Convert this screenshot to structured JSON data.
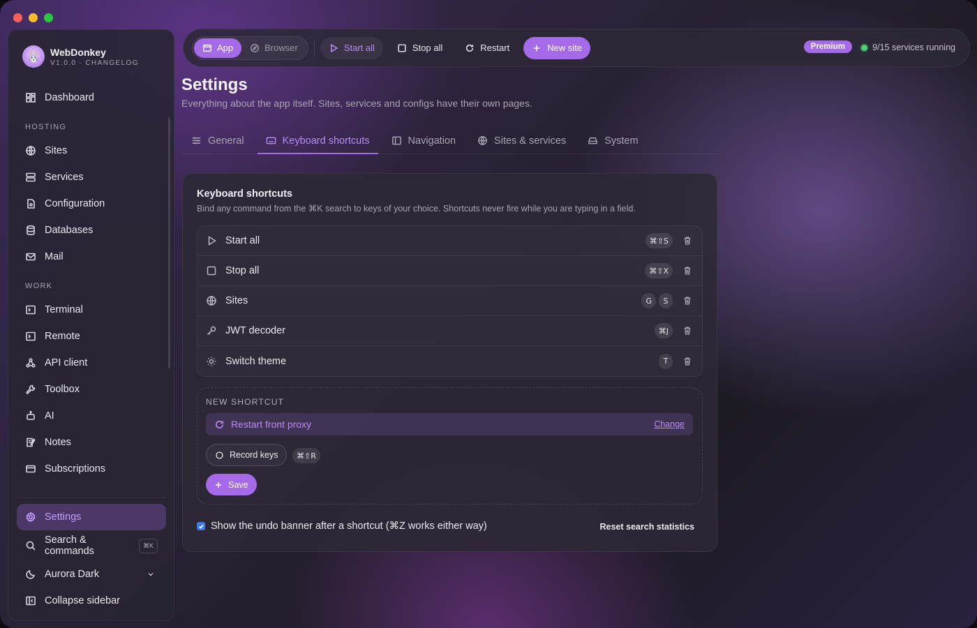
{
  "app": {
    "name": "WebDonkey",
    "version": "V1.0.0 · CHANGELOG"
  },
  "sidebar": {
    "top_items": [
      {
        "label": "Dashboard",
        "icon": "dashboard-icon"
      }
    ],
    "sections": [
      {
        "title": "HOSTING",
        "items": [
          {
            "label": "Sites",
            "icon": "globe-icon"
          },
          {
            "label": "Services",
            "icon": "server-icon"
          },
          {
            "label": "Configuration",
            "icon": "config-file-icon"
          },
          {
            "label": "Databases",
            "icon": "database-icon"
          },
          {
            "label": "Mail",
            "icon": "mail-icon"
          }
        ]
      },
      {
        "title": "WORK",
        "items": [
          {
            "label": "Terminal",
            "icon": "terminal-icon"
          },
          {
            "label": "Remote",
            "icon": "remote-icon"
          },
          {
            "label": "API client",
            "icon": "api-icon"
          },
          {
            "label": "Toolbox",
            "icon": "wrench-icon"
          },
          {
            "label": "AI",
            "icon": "robot-icon"
          },
          {
            "label": "Notes",
            "icon": "notes-icon"
          },
          {
            "label": "Subscriptions",
            "icon": "card-icon"
          }
        ]
      }
    ],
    "bottom": {
      "settings": "Settings",
      "search": "Search & commands",
      "search_kbd": "⌘K",
      "theme": "Aurora Dark",
      "collapse": "Collapse sidebar"
    }
  },
  "topbar": {
    "mode_app": "App",
    "mode_browser": "Browser",
    "start_all": "Start all",
    "stop_all": "Stop all",
    "restart": "Restart",
    "new_site": "New site",
    "premium": "Premium",
    "services_status": "9/15 services running"
  },
  "page": {
    "title": "Settings",
    "subtitle": "Everything about the app itself. Sites, services and configs have their own pages."
  },
  "tabs": [
    {
      "label": "General",
      "icon": "sliders-icon",
      "active": false
    },
    {
      "label": "Keyboard shortcuts",
      "icon": "keyboard-icon",
      "active": true
    },
    {
      "label": "Navigation",
      "icon": "sidebar-layout-icon",
      "active": false
    },
    {
      "label": "Sites & services",
      "icon": "globe-icon",
      "active": false
    },
    {
      "label": "System",
      "icon": "drive-icon",
      "active": false
    }
  ],
  "shortcuts_card": {
    "title": "Keyboard shortcuts",
    "subtitle": "Bind any command from the ⌘K search to keys of your choice. Shortcuts never fire while you are typing in a field.",
    "rows": [
      {
        "label": "Start all",
        "icon": "play-icon",
        "keys": [
          "⌘⇧S"
        ]
      },
      {
        "label": "Stop all",
        "icon": "stop-icon",
        "keys": [
          "⌘⇧X"
        ]
      },
      {
        "label": "Sites",
        "icon": "globe-icon",
        "keys": [
          "G",
          "S"
        ]
      },
      {
        "label": "JWT decoder",
        "icon": "key-icon",
        "keys": [
          "⌘J"
        ]
      },
      {
        "label": "Switch theme",
        "icon": "sun-icon",
        "keys": [
          "T"
        ]
      }
    ],
    "new_shortcut": {
      "label": "NEW SHORTCUT",
      "command": "Restart front proxy",
      "change": "Change",
      "record": "Record keys",
      "recorded": "⌘⇧R",
      "save": "Save"
    },
    "undo_banner": "Show the undo banner after a shortcut (⌘Z works either way)",
    "undo_checked": true,
    "reset": "Reset search statistics"
  },
  "colors": {
    "accent": "#a56ae8",
    "accent_text": "#b98cf3",
    "status_ok": "#4fd07a"
  }
}
